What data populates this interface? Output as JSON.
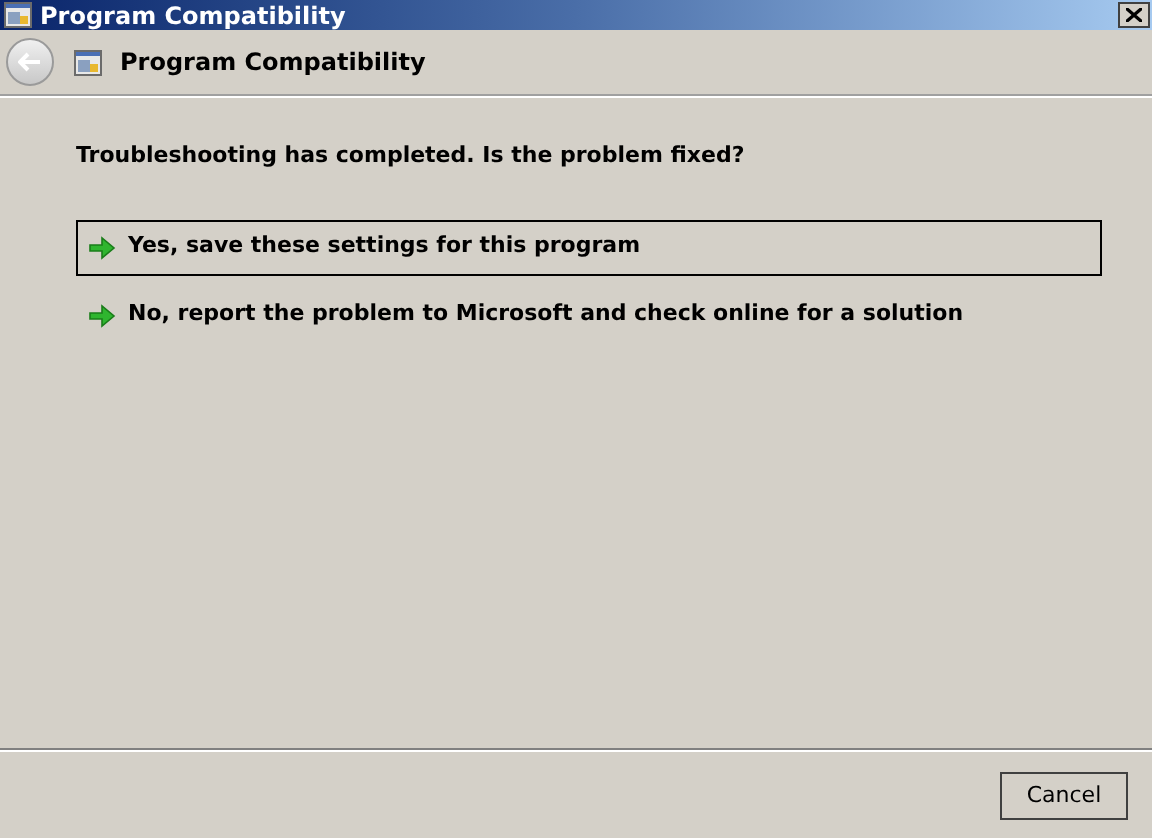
{
  "window": {
    "title": "Program Compatibility"
  },
  "header": {
    "title": "Program Compatibility"
  },
  "question": "Troubleshooting has completed.  Is the problem fixed?",
  "options": [
    {
      "label": "Yes, save these settings for this program",
      "selected": true
    },
    {
      "label": "No, report the problem to Microsoft and check online for a solution",
      "selected": false
    }
  ],
  "footer": {
    "cancel": "Cancel"
  }
}
